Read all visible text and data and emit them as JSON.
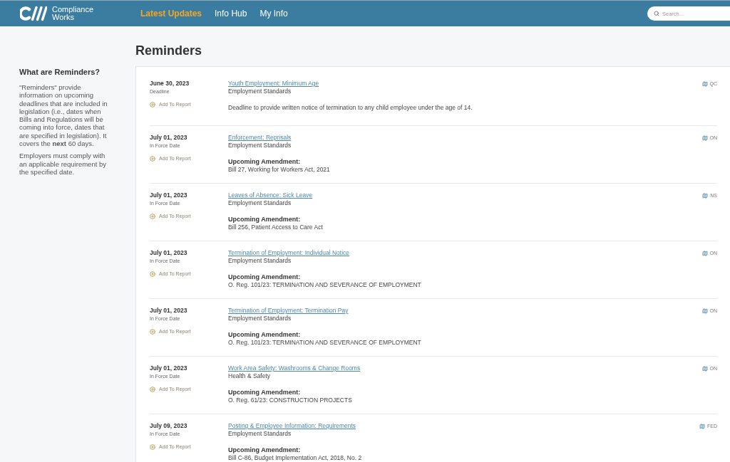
{
  "header": {
    "logo": {
      "line_1": "Compliance",
      "line_2": "Works"
    },
    "nav": [
      {
        "label": "Latest Updates",
        "selected": true
      },
      {
        "label": "Info Hub",
        "selected": false
      },
      {
        "label": "My Info",
        "selected": false
      }
    ],
    "search": {
      "placeholder": "Search..."
    }
  },
  "sidebar": {
    "title": "What are Reminders?",
    "paragraphs": [
      "\"Reminders\" provide information on upcoming deadlines that are included in legislation (i.e., dates when Bills and Regulations will be coming into force, dates that are specified in legislation). It covers the **next** 60 days.",
      "Employers must comply with an applicable requirement by the specified date."
    ]
  },
  "main": {
    "title": "Reminders",
    "reminders": [
      {
        "date": "June 30, 2023",
        "date_type": "Deadline",
        "add_label": "Add To Report",
        "title": "Youth Employment: Minimum Age",
        "category": "Employment Standards",
        "kind": "note",
        "description": "Deadline to provide written notice of termination to any child employee under the age of 14.",
        "jurisdiction": "QC"
      },
      {
        "date": "July 01, 2023",
        "date_type": "In Force Date",
        "add_label": "Add To Report",
        "title": "Enforcement: Reprisals",
        "category": "Employment Standards",
        "kind": "amendment",
        "amendment_label": "Upcoming Amendment:",
        "amendment": "Bill 27, Working for Workers Act, 2021",
        "jurisdiction": "ON"
      },
      {
        "date": "July 01, 2023",
        "date_type": "In Force Date",
        "add_label": "Add To Report",
        "title": "Leaves of Absence: Sick Leave",
        "category": "Employment Standards",
        "kind": "amendment",
        "amendment_label": "Upcoming Amendment:",
        "amendment": "Bill 256, Patient Access to Care Act",
        "jurisdiction": "NS"
      },
      {
        "date": "July 01, 2023",
        "date_type": "In Force Date",
        "add_label": "Add To Report",
        "title": "Termination of Employment: Individual Notice",
        "category": "Employment Standards",
        "kind": "amendment",
        "amendment_label": "Upcoming Amendment:",
        "amendment": "O. Reg. 101/23: TERMINATION AND SEVERANCE OF EMPLOYMENT",
        "jurisdiction": "ON"
      },
      {
        "date": "July 01, 2023",
        "date_type": "In Force Date",
        "add_label": "Add To Report",
        "title": "Termination of Employment: Termination Pay",
        "category": "Employment Standards",
        "kind": "amendment",
        "amendment_label": "Upcoming Amendment:",
        "amendment": "O. Reg. 101/23: TERMINATION AND SEVERANCE OF EMPLOYMENT",
        "jurisdiction": "ON"
      },
      {
        "date": "July 01, 2023",
        "date_type": "In Force Date",
        "add_label": "Add To Report",
        "title": "Work Area Safety: Washrooms & Change Rooms",
        "category": "Health & Safety",
        "kind": "amendment",
        "amendment_label": "Upcoming Amendment:",
        "amendment": "O. Reg. 61/23: CONSTRUCTION PROJECTS",
        "jurisdiction": "ON"
      },
      {
        "date": "July 09, 2023",
        "date_type": "In Force Date",
        "add_label": "Add To Report",
        "title": "Posting & Employee Information: Requirements",
        "category": "Employment Standards",
        "kind": "amendment",
        "amendment_label": "Upcoming Amendment:",
        "amendment": "Bill C-86, Budget Implementation Act, 2018, No. 2",
        "jurisdiction": "FED"
      }
    ]
  }
}
